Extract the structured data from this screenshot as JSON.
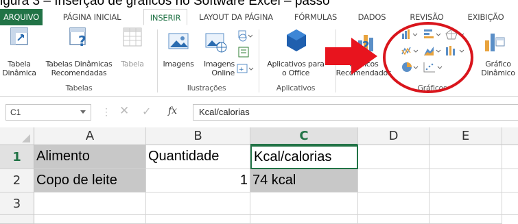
{
  "caption": "igura 3 – Inserção de gráficos no Software Excel – passo",
  "tabs": [
    {
      "label": "ARQUIVO",
      "kind": "file"
    },
    {
      "label": "PÁGINA INICIAL",
      "kind": "normal"
    },
    {
      "label": "INSERIR",
      "kind": "active"
    },
    {
      "label": "LAYOUT DA PÁGINA",
      "kind": "normal"
    },
    {
      "label": "FÓRMULAS",
      "kind": "normal"
    },
    {
      "label": "DADOS",
      "kind": "normal"
    },
    {
      "label": "REVISÃO",
      "kind": "normal"
    },
    {
      "label": "EXIBIÇÃO",
      "kind": "normal"
    }
  ],
  "ribbon": {
    "tabela_dinamica": "Tabela\nDinâmica",
    "tabelas_recomendadas": "Tabelas Dinâmicas\nRecomendadas",
    "tabela": "Tabela",
    "group_tabelas": "Tabelas",
    "imagens": "Imagens",
    "imagens_online": "Imagens\nOnline",
    "group_ilustracoes": "Ilustrações",
    "aplicativos_office": "Aplicativos para\no Office",
    "group_aplicativos": "Aplicativos",
    "graficos_recomendados": "Gráficos\nRecomendados",
    "group_graficos": "Gráficos",
    "grafico_dinamico": "Gráfico\nDinâmico",
    "accent_color": "#217346",
    "arrow_color": "#e8141e",
    "circle_color": "#d9151c"
  },
  "formula_bar": {
    "name_box": "C1",
    "fx_label": "fx",
    "content": "Kcal/calorias"
  },
  "sheet": {
    "columns": [
      "A",
      "B",
      "C",
      "D",
      "E"
    ],
    "rows": [
      "1",
      "2",
      "3"
    ],
    "cells": {
      "A1": "Alimento",
      "B1": "Quantidade",
      "C1": "Kcal/calorias",
      "A2": "Copo de leite",
      "B2": "1",
      "C2": "74 kcal"
    }
  }
}
